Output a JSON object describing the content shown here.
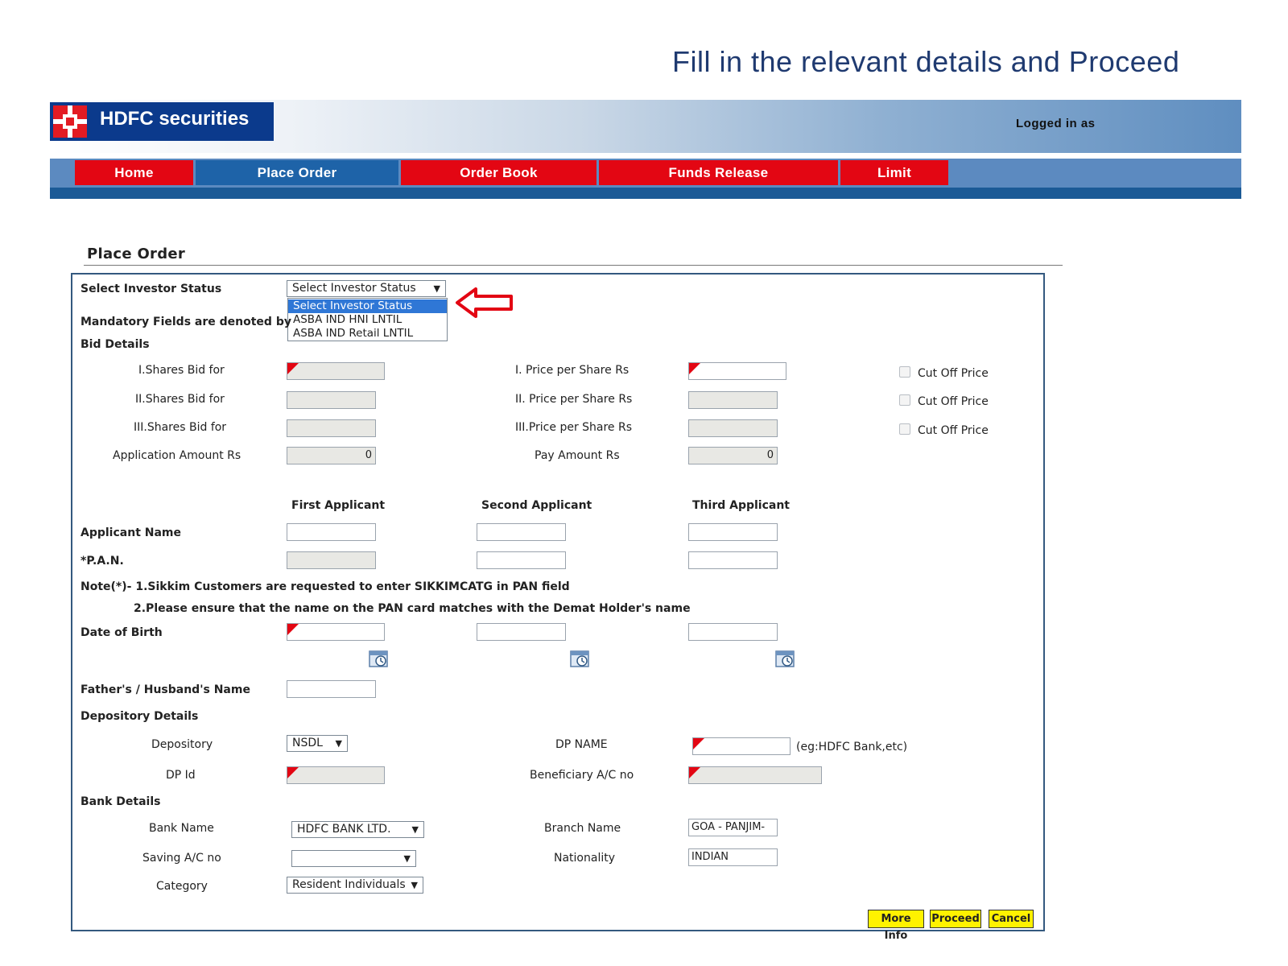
{
  "headline": "Fill in the relevant details and Proceed",
  "header": {
    "brand": "HDFC securities",
    "logged_in_label": "Logged in as"
  },
  "nav": [
    "Home",
    "Place Order",
    "Order Book",
    "Funds Release",
    "Limit"
  ],
  "section_title": "Place Order",
  "investor": {
    "label": "Select Investor Status",
    "selected": "Select Investor Status",
    "options": [
      "Select Investor Status",
      "ASBA IND HNI LNTIL",
      "ASBA IND Retail LNTIL"
    ],
    "mandatory_note": "Mandatory Fields are denoted by"
  },
  "bid": {
    "heading": "Bid Details",
    "shares_labels": [
      "I.Shares Bid for",
      "II.Shares Bid for",
      "III.Shares Bid for"
    ],
    "price_labels": [
      "I.  Price per Share   Rs",
      "II.  Price per Share   Rs",
      "III.Price per Share   Rs"
    ],
    "cutoff_label": "Cut Off Price",
    "app_amount_label": "Application Amount   Rs",
    "app_amount_value": "0",
    "pay_amount_label": "Pay Amount   Rs",
    "pay_amount_value": "0"
  },
  "applicants": {
    "columns": [
      "First Applicant",
      "Second Applicant",
      "Third Applicant"
    ],
    "name_label": "Applicant Name",
    "pan_label": "*P.A.N.",
    "note1": "Note(*)- 1.Sikkim Customers are requested to enter SIKKIMCATG in PAN field",
    "note2": "2.Please ensure that the name on the PAN card matches with the Demat Holder's name",
    "dob_label": "Date of Birth",
    "father_label": "Father's / Husband's Name"
  },
  "depository": {
    "heading": "Depository Details",
    "depository_label": "Depository",
    "depository_value": "NSDL",
    "dp_name_label": "DP NAME",
    "dp_name_hint": "(eg:HDFC Bank,etc)",
    "dp_id_label": "DP Id",
    "beneficiary_label": "Beneficiary A/C no"
  },
  "bank": {
    "heading": "Bank Details",
    "bank_name_label": "Bank Name",
    "bank_name_value": "HDFC BANK LTD.",
    "branch_label": "Branch Name",
    "branch_value": "GOA - PANJIM-",
    "saving_label": "Saving A/C no",
    "nationality_label": "Nationality",
    "nationality_value": "INDIAN",
    "category_label": "Category",
    "category_value": "Resident Individuals"
  },
  "buttons": {
    "more_info": "More Info",
    "proceed": "Proceed",
    "cancel": "Cancel"
  },
  "colors": {
    "nav_red": "#e30613",
    "nav_active_blue": "#1e63a8",
    "button_yellow": "#fff200",
    "mandatory_flag": "#e30613",
    "headline_blue": "#1f3a70"
  }
}
